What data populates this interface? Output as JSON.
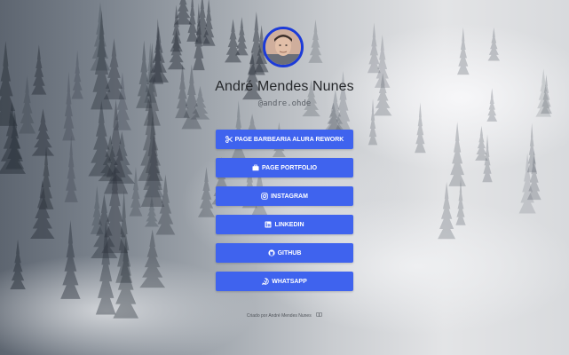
{
  "profile": {
    "name": "André Mendes Nunes",
    "handle": "@andre.ohde",
    "avatar_icon": "profile-photo"
  },
  "links": [
    {
      "label": "PAGE BARBEARIA ALURA REWORK",
      "icon": "scissors-icon"
    },
    {
      "label": "PAGE PORTFOLIO",
      "icon": "briefcase-icon"
    },
    {
      "label": "INSTAGRAM",
      "icon": "instagram-icon"
    },
    {
      "label": "LINKEDIN",
      "icon": "linkedin-icon"
    },
    {
      "label": "GITHUB",
      "icon": "github-icon"
    },
    {
      "label": "WHATSAPP",
      "icon": "whatsapp-icon"
    }
  ],
  "footer": {
    "text": "Criado por André Mendes Nunes",
    "icon": "book-icon"
  },
  "colors": {
    "button": "#3f63ee",
    "avatar_border": "#1c3bd8",
    "name_text": "#26282b"
  }
}
